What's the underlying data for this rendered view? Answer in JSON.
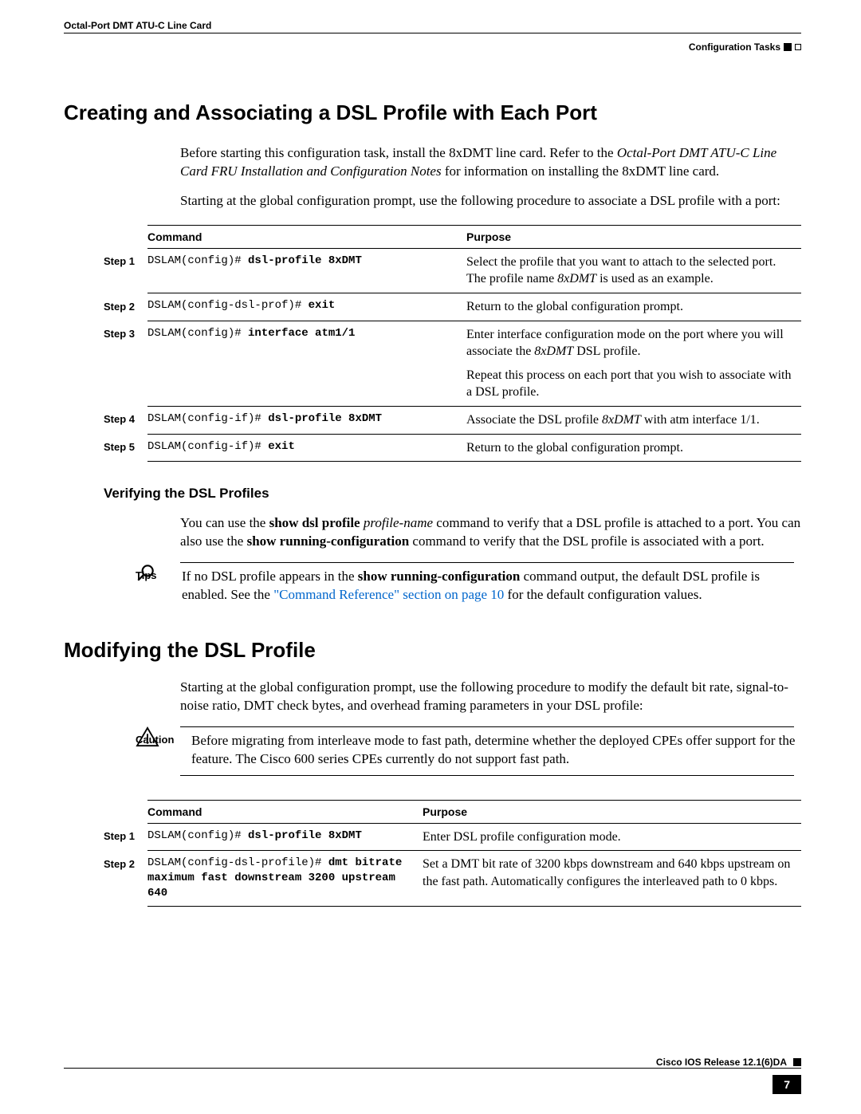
{
  "header": {
    "doc_title": "Octal-Port DMT ATU-C Line Card",
    "section_label": "Configuration Tasks"
  },
  "section1": {
    "title": "Creating and Associating a DSL Profile with Each Port",
    "intro_before_italic": "Before starting this configuration task, install the 8xDMT line card. Refer to the ",
    "intro_italic": "Octal-Port DMT ATU-C Line Card FRU Installation and Configuration Notes",
    "intro_after_italic": " for information on installing the 8xDMT line card.",
    "intro2": "Starting at the global configuration prompt, use the following procedure to associate a DSL profile with a port:",
    "table": {
      "headers": {
        "command": "Command",
        "purpose": "Purpose"
      },
      "rows": [
        {
          "step": "Step 1",
          "prompt": "DSLAM(config)# ",
          "cmd": "dsl-profile 8xDMT",
          "purpose_before_italic": "Select the profile that you want to attach to the selected port. The profile name ",
          "purpose_italic": "8xDMT",
          "purpose_after_italic": " is used as an example."
        },
        {
          "step": "Step 2",
          "prompt": "DSLAM(config-dsl-prof)# ",
          "cmd": "exit",
          "purpose_plain": "Return to the global configuration prompt."
        },
        {
          "step": "Step 3",
          "prompt": "DSLAM(config)# ",
          "cmd": "interface atm1/1",
          "purpose_before_italic": "Enter interface configuration mode on the port where you will associate the ",
          "purpose_italic": "8xDMT",
          "purpose_after_italic": " DSL profile.",
          "purpose_para2": "Repeat this process on each port that you wish to associate with a DSL profile."
        },
        {
          "step": "Step 4",
          "prompt": "DSLAM(config-if)# ",
          "cmd": "dsl-profile 8xDMT",
          "purpose_before_italic": "Associate the DSL profile ",
          "purpose_italic": "8xDMT",
          "purpose_after_italic": " with atm interface 1/1."
        },
        {
          "step": "Step 5",
          "prompt": "DSLAM(config-if)# ",
          "cmd": "exit",
          "purpose_plain": "Return to the global configuration prompt."
        }
      ]
    }
  },
  "verify": {
    "title": "Verifying the DSL Profiles",
    "p_before_b1": "You can use the ",
    "p_b1": "show dsl profile",
    "p_italic": " profile-name",
    "p_mid": " command to verify that a DSL profile is attached to a port. You can also use the ",
    "p_b2": "show running-configuration",
    "p_after": " command to verify that the DSL profile is associated with a port."
  },
  "tips": {
    "label": "Tips",
    "t_before_b": "If no DSL profile appears in the ",
    "t_b": "show running-configuration",
    "t_mid": " command output, the default DSL profile is enabled. See the ",
    "t_link": "\"Command Reference\" section on page 10",
    "t_after": " for the default configuration values."
  },
  "section2": {
    "title": "Modifying the DSL Profile",
    "intro": "Starting at the global configuration prompt, use the following procedure to modify the default bit rate, signal-to-noise ratio, DMT check bytes, and overhead framing parameters in your DSL profile:"
  },
  "caution": {
    "label": "Caution",
    "text": "Before migrating from interleave mode to fast path, determine whether the deployed CPEs offer support for the feature. The Cisco 600 series CPEs currently do not support fast path."
  },
  "table2": {
    "headers": {
      "command": "Command",
      "purpose": "Purpose"
    },
    "rows": [
      {
        "step": "Step 1",
        "prompt": "DSLAM(config)# ",
        "cmd": "dsl-profile 8xDMT",
        "purpose": "Enter DSL profile configuration mode."
      },
      {
        "step": "Step 2",
        "prompt": "DSLAM(config-dsl-profile)# ",
        "cmd": "dmt bitrate maximum fast downstream 3200 upstream 640",
        "purpose": "Set a DMT bit rate of 3200 kbps downstream and 640 kbps upstream on the fast path. Automatically configures the interleaved path to 0 kbps."
      }
    ]
  },
  "footer": {
    "release": "Cisco IOS Release 12.1(6)DA",
    "page": "7"
  }
}
